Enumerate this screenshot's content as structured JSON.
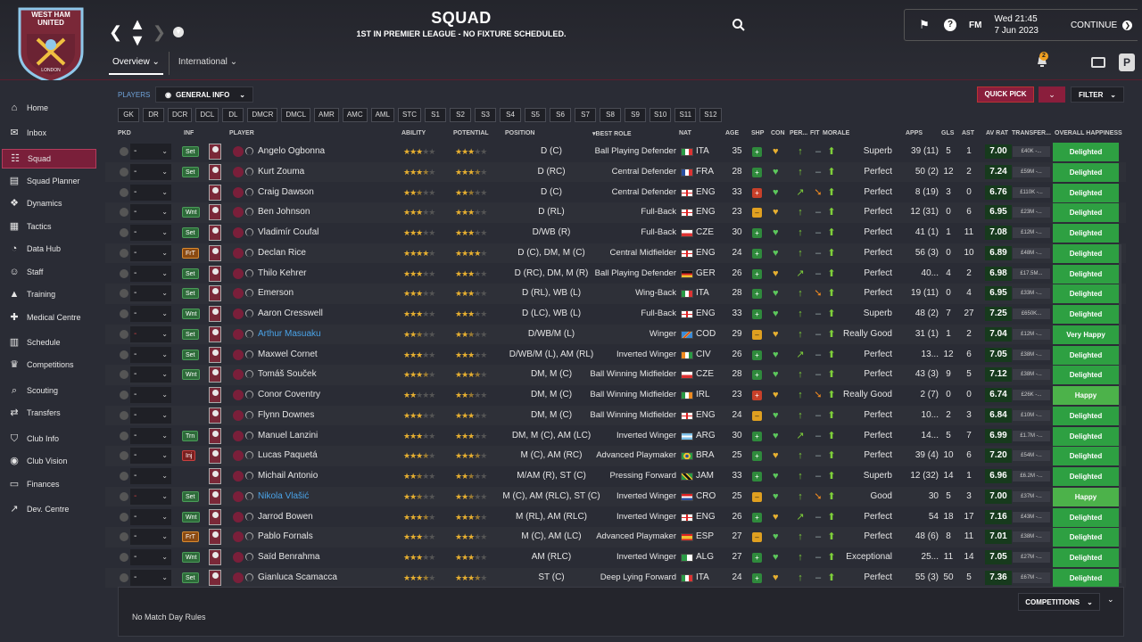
{
  "header": {
    "title": "SQUAD",
    "subtitle": "1ST IN PREMIER LEAGUE - NO FIXTURE SCHEDULED.",
    "crest_text": "WEST HAM UNITED",
    "crest_sub": "LONDON",
    "fm_logo": "FM",
    "date_time": "Wed 21:45",
    "date": "7 Jun 2023",
    "continue_label": "CONTINUE",
    "notification_count": "2"
  },
  "subtabs": [
    {
      "label": "Overview"
    },
    {
      "label": "International"
    }
  ],
  "sidebar": {
    "items": [
      {
        "label": "Home",
        "icon": "home-icon"
      },
      {
        "label": "Inbox",
        "icon": "inbox-icon"
      },
      {
        "label": "Squad",
        "icon": "squad-icon"
      },
      {
        "label": "Squad Planner",
        "icon": "planner-icon"
      },
      {
        "label": "Dynamics",
        "icon": "dynamics-icon"
      },
      {
        "label": "Tactics",
        "icon": "tactics-icon"
      },
      {
        "label": "Data Hub",
        "icon": "datahub-icon"
      },
      {
        "label": "Staff",
        "icon": "staff-icon"
      },
      {
        "label": "Training",
        "icon": "training-icon"
      },
      {
        "label": "Medical Centre",
        "icon": "medical-icon"
      },
      {
        "label": "Schedule",
        "icon": "schedule-icon"
      },
      {
        "label": "Competitions",
        "icon": "trophy-icon"
      },
      {
        "label": "Scouting",
        "icon": "scouting-icon"
      },
      {
        "label": "Transfers",
        "icon": "transfers-icon"
      },
      {
        "label": "Club Info",
        "icon": "shield-icon"
      },
      {
        "label": "Club Vision",
        "icon": "vision-icon"
      },
      {
        "label": "Finances",
        "icon": "finances-icon"
      },
      {
        "label": "Dev. Centre",
        "icon": "dev-icon"
      }
    ],
    "active": "Squad"
  },
  "toolbar": {
    "players_label": "PLAYERS",
    "view_label": "GENERAL INFO",
    "quick_pick": "QUICK PICK",
    "filter": "FILTER"
  },
  "position_filters": [
    "GK",
    "DR",
    "DCR",
    "DCL",
    "DL",
    "DMCR",
    "DMCL",
    "AMR",
    "AMC",
    "AML",
    "STC",
    "S1",
    "S2",
    "S3",
    "S4",
    "S5",
    "S6",
    "S7",
    "S8",
    "S9",
    "S10",
    "S11",
    "S12"
  ],
  "columns": {
    "pkd": "PKD",
    "inf": "INF",
    "player": "PLAYER",
    "ability": "ABILITY",
    "potential": "POTENTIAL",
    "position": "POSITION",
    "best_role": "BEST ROLE",
    "nat": "NAT",
    "age": "AGE",
    "shp": "SHP",
    "con": "CON",
    "per": "PER...",
    "fit": "FIT",
    "morale": "MORALE",
    "apps": "APPS",
    "gls": "GLS",
    "ast": "AST",
    "av_rat": "AV RAT",
    "transfer": "TRANSFER...",
    "happiness": "OVERALL HAPPINESS"
  },
  "players": [
    {
      "name": "Angelo Ogbonna",
      "inf": "Set",
      "ability": 3,
      "potential": 3,
      "position": "D (C)",
      "role": "Ball Playing Defender",
      "nat": "ITA",
      "age": "35",
      "shp": "g",
      "morale": "Superb",
      "apps": "39 (11)",
      "gls": "5",
      "ast": "1",
      "rat": "7.00",
      "fee": "£40K -...",
      "happiness": "Delighted",
      "loan": false
    },
    {
      "name": "Kurt Zouma",
      "inf": "Set",
      "ability": 3.5,
      "potential": 3.5,
      "position": "D (RC)",
      "role": "Central Defender",
      "nat": "FRA",
      "age": "28",
      "shp": "g",
      "morale": "Perfect",
      "apps": "50 (2)",
      "gls": "12",
      "ast": "2",
      "rat": "7.24",
      "fee": "£59M -...",
      "happiness": "Delighted",
      "loan": false
    },
    {
      "name": "Craig Dawson",
      "inf": "",
      "ability": 2.5,
      "potential": 2.5,
      "position": "D (C)",
      "role": "Central Defender",
      "nat": "ENG",
      "age": "33",
      "shp": "r",
      "morale": "Perfect",
      "apps": "8 (19)",
      "gls": "3",
      "ast": "0",
      "rat": "6.76",
      "fee": "£110K -...",
      "happiness": "Delighted",
      "loan": false
    },
    {
      "name": "Ben Johnson",
      "inf": "Wnt",
      "ability": 3,
      "potential": 3,
      "position": "D (RL)",
      "role": "Full-Back",
      "nat": "ENG",
      "age": "23",
      "shp": "y",
      "morale": "Perfect",
      "apps": "12 (31)",
      "gls": "0",
      "ast": "6",
      "rat": "6.95",
      "fee": "£23M -...",
      "happiness": "Delighted",
      "loan": false
    },
    {
      "name": "Vladimír Coufal",
      "inf": "Set",
      "ability": 3,
      "potential": 3,
      "position": "D/WB (R)",
      "role": "Full-Back",
      "nat": "CZE",
      "age": "30",
      "shp": "g",
      "morale": "Perfect",
      "apps": "41 (1)",
      "gls": "1",
      "ast": "11",
      "rat": "7.08",
      "fee": "£12M -...",
      "happiness": "Delighted",
      "loan": false
    },
    {
      "name": "Declan Rice",
      "inf": "FrT",
      "ability": 4,
      "potential": 4,
      "position": "D (C), DM, M (C)",
      "role": "Central Midfielder",
      "nat": "ENG",
      "age": "24",
      "shp": "g",
      "morale": "Perfect",
      "apps": "56 (3)",
      "gls": "0",
      "ast": "10",
      "rat": "6.89",
      "fee": "£48M -...",
      "happiness": "Delighted",
      "loan": false
    },
    {
      "name": "Thilo Kehrer",
      "inf": "Set",
      "ability": 3,
      "potential": 3,
      "position": "D (RC), DM, M (R)",
      "role": "Ball Playing Defender",
      "nat": "GER",
      "age": "26",
      "shp": "g",
      "morale": "Perfect",
      "apps": "40...",
      "gls": "4",
      "ast": "2",
      "rat": "6.98",
      "fee": "£17.5M...",
      "happiness": "Delighted",
      "loan": false
    },
    {
      "name": "Emerson",
      "inf": "Set",
      "ability": 3,
      "potential": 3,
      "position": "D (RL), WB (L)",
      "role": "Wing-Back",
      "nat": "ITA",
      "age": "28",
      "shp": "g",
      "morale": "Perfect",
      "apps": "19 (11)",
      "gls": "0",
      "ast": "4",
      "rat": "6.95",
      "fee": "£33M -...",
      "happiness": "Delighted",
      "loan": false
    },
    {
      "name": "Aaron Cresswell",
      "inf": "Wnt",
      "ability": 3,
      "potential": 3,
      "position": "D (LC), WB (L)",
      "role": "Full-Back",
      "nat": "ENG",
      "age": "33",
      "shp": "g",
      "morale": "Superb",
      "apps": "48 (2)",
      "gls": "7",
      "ast": "27",
      "rat": "7.25",
      "fee": "£650K...",
      "happiness": "Delighted",
      "loan": false
    },
    {
      "name": "Arthur Masuaku",
      "inf": "Set",
      "ability": 2.5,
      "potential": 2.5,
      "position": "D/WB/M (L)",
      "role": "Winger",
      "nat": "COD",
      "age": "29",
      "shp": "y",
      "morale": "Really Good",
      "apps": "31 (1)",
      "gls": "1",
      "ast": "2",
      "rat": "7.04",
      "fee": "£12M -...",
      "happiness": "Very Happy",
      "loan": true
    },
    {
      "name": "Maxwel Cornet",
      "inf": "Set",
      "ability": 3,
      "potential": 3,
      "position": "D/WB/M (L), AM (RL)",
      "role": "Inverted Winger",
      "nat": "CIV",
      "age": "26",
      "shp": "g",
      "morale": "Perfect",
      "apps": "13...",
      "gls": "12",
      "ast": "6",
      "rat": "7.05",
      "fee": "£38M -...",
      "happiness": "Delighted",
      "loan": false
    },
    {
      "name": "Tomáš Souček",
      "inf": "Wnt",
      "ability": 3.5,
      "potential": 3.5,
      "position": "DM, M (C)",
      "role": "Ball Winning Midfielder",
      "nat": "CZE",
      "age": "28",
      "shp": "g",
      "morale": "Perfect",
      "apps": "43 (3)",
      "gls": "9",
      "ast": "5",
      "rat": "7.12",
      "fee": "£38M -...",
      "happiness": "Delighted",
      "loan": false
    },
    {
      "name": "Conor Coventry",
      "inf": "",
      "ability": 2,
      "potential": 2.5,
      "position": "DM, M (C)",
      "role": "Ball Winning Midfielder",
      "nat": "IRL",
      "age": "23",
      "shp": "r",
      "morale": "Really Good",
      "apps": "2 (7)",
      "gls": "0",
      "ast": "0",
      "rat": "6.74",
      "fee": "£26K -...",
      "happiness": "Happy",
      "loan": false
    },
    {
      "name": "Flynn Downes",
      "inf": "",
      "ability": 3,
      "potential": 3,
      "position": "DM, M (C)",
      "role": "Ball Winning Midfielder",
      "nat": "ENG",
      "age": "24",
      "shp": "y",
      "morale": "Perfect",
      "apps": "10...",
      "gls": "2",
      "ast": "3",
      "rat": "6.84",
      "fee": "£10M -...",
      "happiness": "Delighted",
      "loan": false
    },
    {
      "name": "Manuel Lanzini",
      "inf": "Trn",
      "ability": 3,
      "potential": 3,
      "position": "DM, M (C), AM (LC)",
      "role": "Inverted Winger",
      "nat": "ARG",
      "age": "30",
      "shp": "g",
      "morale": "Perfect",
      "apps": "14...",
      "gls": "5",
      "ast": "7",
      "rat": "6.99",
      "fee": "£1.7M -...",
      "happiness": "Delighted",
      "loan": false
    },
    {
      "name": "Lucas Paquetá",
      "inf": "Inj",
      "ability": 3.5,
      "potential": 3.5,
      "position": "M (C), AM (RC)",
      "role": "Advanced Playmaker",
      "nat": "BRA",
      "age": "25",
      "shp": "g",
      "morale": "Perfect",
      "apps": "39 (4)",
      "gls": "10",
      "ast": "6",
      "rat": "7.20",
      "fee": "£54M -...",
      "happiness": "Delighted",
      "loan": false
    },
    {
      "name": "Michail Antonio",
      "inf": "",
      "ability": 2.5,
      "potential": 2.5,
      "position": "M/AM (R), ST (C)",
      "role": "Pressing Forward",
      "nat": "JAM",
      "age": "33",
      "shp": "g",
      "morale": "Superb",
      "apps": "12 (32)",
      "gls": "14",
      "ast": "1",
      "rat": "6.96",
      "fee": "£6.2M -...",
      "happiness": "Delighted",
      "loan": false
    },
    {
      "name": "Nikola Vlašić",
      "inf": "Set",
      "ability": 2.5,
      "potential": 2.5,
      "position": "M (C), AM (RLC), ST (C)",
      "role": "Inverted Winger",
      "nat": "CRO",
      "age": "25",
      "shp": "y",
      "morale": "Good",
      "apps": "30",
      "gls": "5",
      "ast": "3",
      "rat": "7.00",
      "fee": "£37M -...",
      "happiness": "Happy",
      "loan": true
    },
    {
      "name": "Jarrod Bowen",
      "inf": "Wnt",
      "ability": 3.5,
      "potential": 3.5,
      "position": "M (RL), AM (RLC)",
      "role": "Inverted Winger",
      "nat": "ENG",
      "age": "26",
      "shp": "g",
      "morale": "Perfect",
      "apps": "54",
      "gls": "18",
      "ast": "17",
      "rat": "7.16",
      "fee": "£43M -...",
      "happiness": "Delighted",
      "loan": false
    },
    {
      "name": "Pablo Fornals",
      "inf": "FrT",
      "ability": 3,
      "potential": 3,
      "position": "M (C), AM (LC)",
      "role": "Advanced Playmaker",
      "nat": "ESP",
      "age": "27",
      "shp": "y",
      "morale": "Perfect",
      "apps": "48 (6)",
      "gls": "8",
      "ast": "11",
      "rat": "7.01",
      "fee": "£38M -...",
      "happiness": "Delighted",
      "loan": false
    },
    {
      "name": "Saïd Benrahma",
      "inf": "Wnt",
      "ability": 3,
      "potential": 3,
      "position": "AM (RLC)",
      "role": "Inverted Winger",
      "nat": "ALG",
      "age": "27",
      "shp": "g",
      "morale": "Exceptional",
      "apps": "25...",
      "gls": "11",
      "ast": "14",
      "rat": "7.05",
      "fee": "£27M -...",
      "happiness": "Delighted",
      "loan": false
    },
    {
      "name": "Gianluca Scamacca",
      "inf": "Set",
      "ability": 3.5,
      "potential": 3.5,
      "position": "ST (C)",
      "role": "Deep Lying Forward",
      "nat": "ITA",
      "age": "24",
      "shp": "g",
      "morale": "Perfect",
      "apps": "55 (3)",
      "gls": "50",
      "ast": "5",
      "rat": "7.36",
      "fee": "£67M -...",
      "happiness": "Delighted",
      "loan": false
    }
  ],
  "pkd_value": "-",
  "footer": {
    "match_day_rules": "No Match Day Rules",
    "competitions": "COMPETITIONS"
  },
  "colors": {
    "accent": "#7a1f3a",
    "happy_green": "#2ea042",
    "loan_blue": "#4aa3e8"
  }
}
